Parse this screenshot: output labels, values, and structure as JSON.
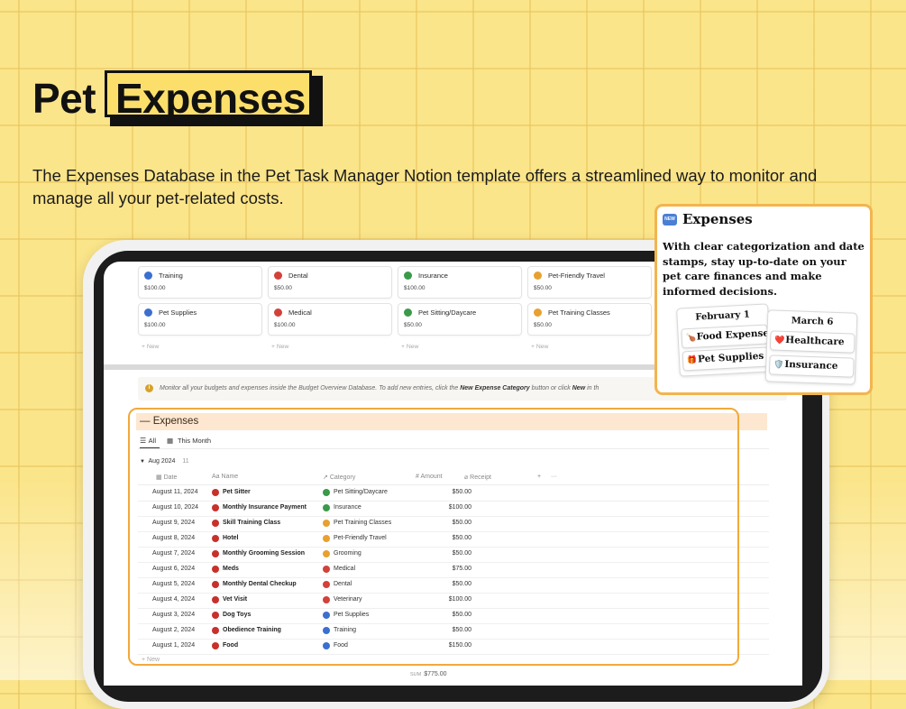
{
  "hero": {
    "title_plain": "Pet",
    "title_boxed": "Expenses",
    "subtitle": "The Expenses Database in the Pet Task Manager Notion template offers a streamlined way to monitor and manage all your pet-related costs."
  },
  "budget_cards": [
    {
      "label": "Training",
      "value": "$100.00",
      "color": "#3b6fd0"
    },
    {
      "label": "Dental",
      "value": "$50.00",
      "color": "#d2413a"
    },
    {
      "label": "Insurance",
      "value": "$100.00",
      "color": "#3a9a4a"
    },
    {
      "label": "Pet-Friendly Travel",
      "value": "$50.00",
      "color": "#e8a030"
    },
    {
      "label": "Pet Supplies",
      "value": "$100.00",
      "color": "#3b6fd0"
    },
    {
      "label": "Medical",
      "value": "$100.00",
      "color": "#d2413a"
    },
    {
      "label": "Pet Sitting/Daycare",
      "value": "$50.00",
      "color": "#3a9a4a"
    },
    {
      "label": "Pet Training Classes",
      "value": "$50.00",
      "color": "#e8a030"
    }
  ],
  "new_label": "+ New",
  "callout": {
    "pre": "Monitor all your budgets and expenses inside the Budget Overview Database. To add new entries, click the",
    "bold1": "New Expense Category",
    "mid": "button or click",
    "bold2": "New",
    "post": "in th"
  },
  "database": {
    "title": "— Expenses",
    "tabs": [
      {
        "label": "All"
      },
      {
        "label": "This Month"
      }
    ],
    "group": {
      "label": "Aug 2024",
      "count": "11"
    },
    "columns": {
      "date": "Date",
      "name": "Name",
      "category": "Category",
      "amount": "Amount",
      "receipt": "Receipt",
      "add": "+",
      "more": "···"
    },
    "rows": [
      {
        "date": "August 11, 2024",
        "name": "Pet Sitter",
        "category": "Pet Sitting/Daycare",
        "cat_color": "#3a9a4a",
        "amount": "$50.00"
      },
      {
        "date": "August 10, 2024",
        "name": "Monthly Insurance Payment",
        "category": "Insurance",
        "cat_color": "#3a9a4a",
        "amount": "$100.00"
      },
      {
        "date": "August 9, 2024",
        "name": "Skill Training Class",
        "category": "Pet Training Classes",
        "cat_color": "#e8a030",
        "amount": "$50.00"
      },
      {
        "date": "August 8, 2024",
        "name": "Hotel",
        "category": "Pet-Friendly Travel",
        "cat_color": "#e8a030",
        "amount": "$50.00"
      },
      {
        "date": "August 7, 2024",
        "name": "Monthly Grooming Session",
        "category": "Grooming",
        "cat_color": "#e8a030",
        "amount": "$50.00"
      },
      {
        "date": "August 6, 2024",
        "name": "Meds",
        "category": "Medical",
        "cat_color": "#d2413a",
        "amount": "$75.00"
      },
      {
        "date": "August 5, 2024",
        "name": "Monthly Dental Checkup",
        "category": "Dental",
        "cat_color": "#d2413a",
        "amount": "$50.00"
      },
      {
        "date": "August 4, 2024",
        "name": "Vet Visit",
        "category": "Veterinary",
        "cat_color": "#d2413a",
        "amount": "$100.00"
      },
      {
        "date": "August 3, 2024",
        "name": "Dog Toys",
        "category": "Pet Supplies",
        "cat_color": "#3b6fd0",
        "amount": "$50.00"
      },
      {
        "date": "August 2, 2024",
        "name": "Obedience Training",
        "category": "Training",
        "cat_color": "#3b6fd0",
        "amount": "$50.00"
      },
      {
        "date": "August 1, 2024",
        "name": "Food",
        "category": "Food",
        "cat_color": "#3b6fd0",
        "amount": "$150.00"
      }
    ],
    "new_row": "+ New",
    "sum_label": "SUM",
    "sum_value": "$775.00"
  },
  "popup": {
    "badge": "NEW",
    "title": "Expenses",
    "description": "With clear categorization and date stamps, stay up-to-date on your pet care finances and make informed decisions.",
    "card1": {
      "date": "February 1",
      "items": [
        {
          "icon": "🍗",
          "label": "Food Expense"
        },
        {
          "icon": "🎁",
          "label": "Pet Supplies"
        }
      ]
    },
    "card2": {
      "date": "March 6",
      "items": [
        {
          "icon": "❤️",
          "label": "Healthcare"
        },
        {
          "icon": "🛡️",
          "label": "Insurance"
        }
      ]
    }
  }
}
